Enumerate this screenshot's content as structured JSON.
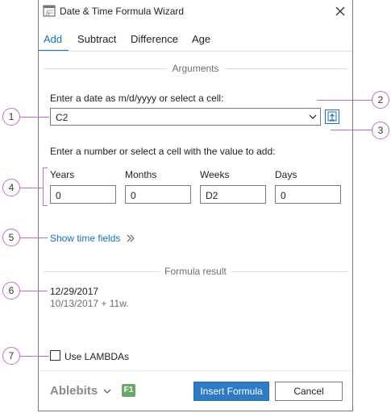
{
  "window": {
    "title": "Date & Time Formula Wizard"
  },
  "tabs": [
    {
      "label": "Add",
      "active": true
    },
    {
      "label": "Subtract",
      "active": false
    },
    {
      "label": "Difference",
      "active": false
    },
    {
      "label": "Age",
      "active": false
    }
  ],
  "arguments": {
    "heading": "Arguments",
    "date_prompt": "Enter a date as m/d/yyyy or select a cell:",
    "date_value": "C2",
    "number_prompt": "Enter a number or select a cell with the value to add:",
    "fields": [
      {
        "label": "Years",
        "value": "0"
      },
      {
        "label": "Months",
        "value": "0"
      },
      {
        "label": "Weeks",
        "value": "D2"
      },
      {
        "label": "Days",
        "value": "0"
      }
    ],
    "show_time_link": "Show time fields"
  },
  "result": {
    "heading": "Formula result",
    "value": "12/29/2017",
    "explanation": "10/13/2017 + 11w."
  },
  "options": {
    "use_lambdas_label": "Use LAMBDAs",
    "use_lambdas_checked": false
  },
  "footer": {
    "brand": "Ablebits",
    "f1_label": "F1",
    "insert_label": "Insert Formula",
    "cancel_label": "Cancel"
  },
  "callouts": [
    "1",
    "2",
    "3",
    "4",
    "5",
    "6",
    "7"
  ],
  "colors": {
    "accent": "#1a6fb5",
    "callout": "#c46ad0",
    "primary_button": "#2d7bc4",
    "f1_badge": "#6aa56a"
  }
}
